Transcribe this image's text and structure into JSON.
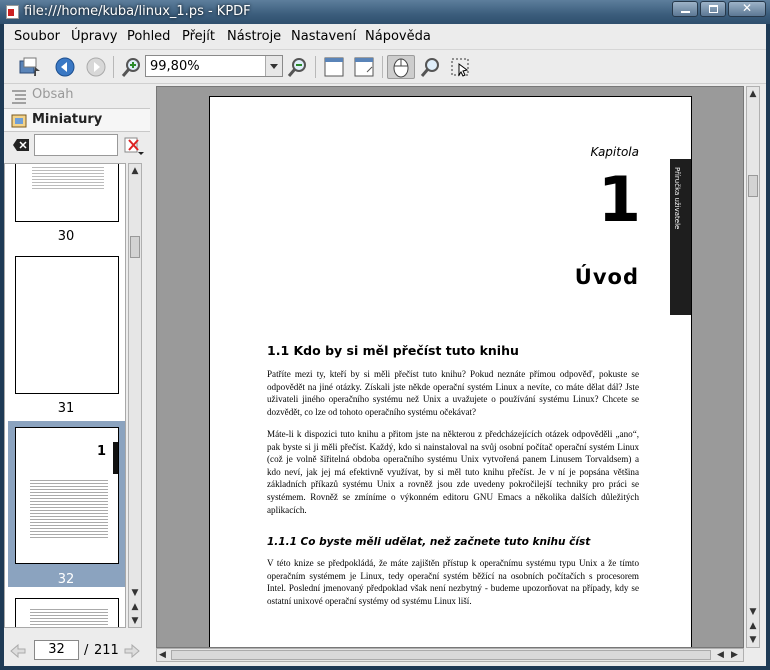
{
  "window": {
    "title": "file:///home/kuba/linux_1.ps - KPDF"
  },
  "menu": [
    "Soubor",
    "Úpravy",
    "Pohled",
    "Přejít",
    "Nástroje",
    "Nastavení",
    "Nápověda"
  ],
  "toolbar": {
    "zoom_value": "99,80%"
  },
  "sidebar": {
    "tab_contents": "Obsah",
    "tab_thumbnails": "Miniatury",
    "filter_value": "",
    "thumbnails": [
      {
        "page": "30"
      },
      {
        "page": "31"
      },
      {
        "page": "32",
        "selected": true
      }
    ]
  },
  "navigation": {
    "current_page": "32",
    "separator": "/",
    "total_pages": "211"
  },
  "document": {
    "chapter_label": "Kapitola",
    "chapter_number": "1",
    "side_tab": "Příručka uživatele",
    "chapter_title": "Úvod",
    "section_1": "1.1 Kdo by si měl přečíst tuto knihu",
    "para_1": "Patříte mezi ty, kteří by si měli přečíst tuto knihu? Pokud neznáte přímou odpověď, pokuste se odpovědět na jiné otázky. Získali jste někde operační systém Linux a nevíte, co máte dělat dál? Jste uživateli jiného operačního systému než Unix a uvažujete o používání systému Linux? Chcete se dozvědět, co lze od tohoto operačního systému očekávat?",
    "para_2": "Máte-li k dispozici tuto knihu a přitom jste na některou z předcházejících otázek odpověděli „ano“, pak byste si ji měli přečíst. Každý, kdo si nainstaloval na svůj osobní počítač operační systém Linux (což je volně šiřitelná obdoba operačního systému Unix vytvořená panem Linusem Torvaldsem) a kdo neví, jak jej má efektivně využívat, by si měl tuto knihu přečíst. Je v ní je popsána většina základních příkazů systému Unix a rovněž jsou zde uvedeny pokročilejší techniky pro práci se systémem. Rovněž se zmíníme o výkonném editoru GNU Emacs a několika dalších důležitých aplikacích.",
    "section_2": "1.1.1 Co byste měli udělat, než začnete tuto knihu číst",
    "para_3": "V této knize se předpokládá, že máte zajištěn přístup k operačnímu systému typu Unix a že tímto operačním systémem je Linux, tedy operační systém běžící na osobních počítačích s procesorem Intel. Poslední jmenovaný předpoklad však není nezbytný - budeme upozorňovat na případy, kdy se ostatní unixové operační systémy od systému Linux liší."
  }
}
